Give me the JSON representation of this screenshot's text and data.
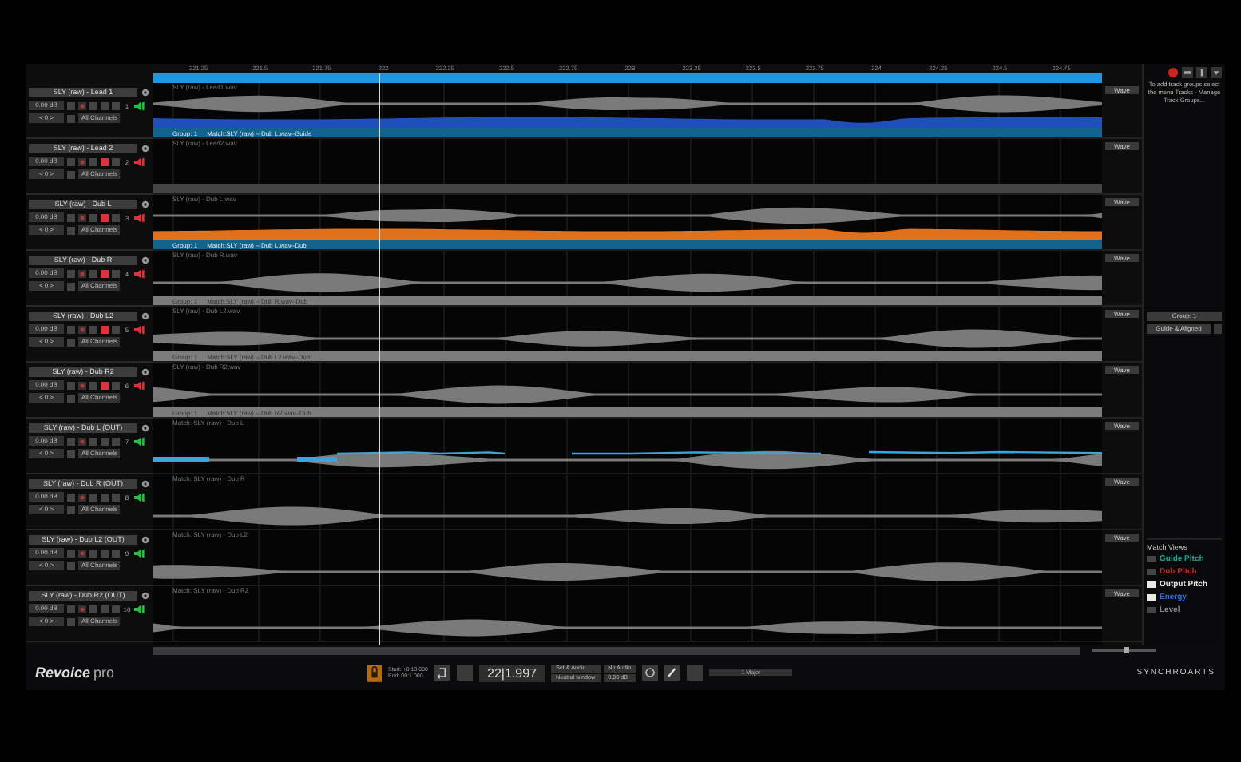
{
  "ruler": {
    "ticks": [
      "221.25",
      "221.5",
      "221.75",
      "222",
      "222.25",
      "222.5",
      "222.75",
      "223",
      "223.25",
      "223.5",
      "223.75",
      "224",
      "224.25",
      "224.5",
      "224.75"
    ]
  },
  "tracks": [
    {
      "name": "SLY (raw) - Lead 1",
      "gain": "0.00 dB",
      "offset": "< 0 >",
      "channels": "All Channels",
      "number": "1",
      "muted": false,
      "file": "SLY (raw) - Lead1.wav",
      "kind": "guide",
      "group_bar": {
        "kind": "match",
        "group": "Group: 1",
        "label": "Match:SLY (raw) – Dub L.wav–Guide"
      },
      "view": "Wave"
    },
    {
      "name": "SLY (raw) - Lead 2",
      "gain": "0.00 dB",
      "offset": "< 0 >",
      "channels": "All Channels",
      "number": "2",
      "muted": true,
      "file": "SLY (raw) - Lead2.wav",
      "kind": "silent",
      "group_bar": {
        "kind": "empty"
      },
      "view": "Wave"
    },
    {
      "name": "SLY (raw) - Dub L",
      "gain": "0.00 dB",
      "offset": "< 0 >",
      "channels": "All Channels",
      "number": "3",
      "muted": true,
      "file": "SLY (raw) - Dub L.wav",
      "kind": "dub",
      "group_bar": {
        "kind": "match",
        "group": "Group: 1",
        "label": "Match:SLY (raw) – Dub L.wav–Dub"
      },
      "view": "Wave"
    },
    {
      "name": "SLY (raw) - Dub R",
      "gain": "0.00 dB",
      "offset": "< 0 >",
      "channels": "All Channels",
      "number": "4",
      "muted": true,
      "file": "SLY (raw) - Dub R.wav",
      "kind": "audio",
      "group_bar": {
        "kind": "inactive",
        "group": "Group: 1",
        "label": "Match:SLY (raw) – Dub R.wav–Dub"
      },
      "view": "Wave"
    },
    {
      "name": "SLY (raw) - Dub L2",
      "gain": "0.00 dB",
      "offset": "< 0 >",
      "channels": "All Channels",
      "number": "5",
      "muted": true,
      "file": "SLY (raw) - Dub L2.wav",
      "kind": "audio",
      "group_bar": {
        "kind": "inactive",
        "group": "Group: 1",
        "label": "Match:SLY (raw) – Dub L2.wav–Dub"
      },
      "view": "Wave"
    },
    {
      "name": "SLY (raw) - Dub R2",
      "gain": "0.00 dB",
      "offset": "< 0 >",
      "channels": "All Channels",
      "number": "6",
      "muted": true,
      "file": "SLY (raw) - Dub R2.wav",
      "kind": "audio",
      "group_bar": {
        "kind": "inactive",
        "group": "Group: 1",
        "label": "Match:SLY (raw) – Dub R2.wav–Dub"
      },
      "view": "Wave"
    },
    {
      "name": "SLY (raw) - Dub L (OUT)",
      "gain": "0.00 dB",
      "offset": "< 0 >",
      "channels": "All Channels",
      "number": "7",
      "muted": false,
      "file": "Match: SLY (raw) - Dub L",
      "kind": "output-pitch",
      "view": "Wave"
    },
    {
      "name": "SLY (raw) - Dub R (OUT)",
      "gain": "0.00 dB",
      "offset": "< 0 >",
      "channels": "All Channels",
      "number": "8",
      "muted": false,
      "file": "Match: SLY (raw) - Dub R",
      "kind": "output",
      "view": "Wave"
    },
    {
      "name": "SLY (raw) - Dub L2 (OUT)",
      "gain": "0.00 dB",
      "offset": "< 0 >",
      "channels": "All Channels",
      "number": "9",
      "muted": false,
      "file": "Match: SLY (raw) - Dub L2",
      "kind": "output",
      "view": "Wave"
    },
    {
      "name": "SLY (raw) - Dub R2 (OUT)",
      "gain": "0.00 dB",
      "offset": "< 0 >",
      "channels": "All Channels",
      "number": "10",
      "muted": false,
      "file": "Match: SLY (raw) - Dub R2",
      "kind": "output",
      "view": "Wave"
    }
  ],
  "panel": {
    "hint": "To add track groups select the menu Tracks - Manage Track Groups...",
    "group_button": "Group: 1",
    "group_mode": "Guide & Aligned",
    "match_views_title": "Match Views",
    "match_views": [
      {
        "label": "Guide Pitch",
        "color": "#1fa58f",
        "checked": false
      },
      {
        "label": "Dub Pitch",
        "color": "#c0302a",
        "checked": false
      },
      {
        "label": "Output Pitch",
        "color": "#e8e8e8",
        "checked": true
      },
      {
        "label": "Energy",
        "color": "#2f6fe0",
        "checked": true
      },
      {
        "label": "Level",
        "color": "#8a8a9a",
        "checked": false
      }
    ]
  },
  "bottom_bar": {
    "logo": "Revoice",
    "logo_suffix": "pro",
    "start": "Start: +0:13.000",
    "end": "End: 00:1.000",
    "time": "22|1.997",
    "dropdowns": [
      "Set & Audio",
      "No Audio",
      "Neutral window",
      "0.00 dB"
    ],
    "zoom": {
      "level": 0.55
    },
    "key": "1 Major",
    "brand": "SYNCHROARTS"
  }
}
